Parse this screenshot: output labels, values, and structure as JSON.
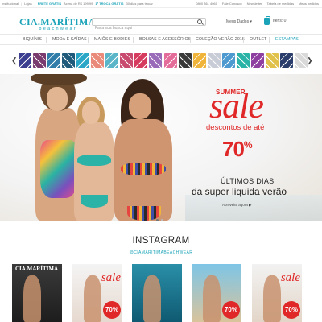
{
  "topbar": {
    "left": [
      "Institucional",
      "Lojas",
      "FRETE GRÁTIS",
      "Acima de R$ 199,99",
      "1ª TROCA GRÁTIS",
      "30 dias para trocar"
    ],
    "right": [
      "0800 361 4061",
      "Fale Conosco",
      "Newsletter",
      "Tabela de medidas",
      "Meus pedidos"
    ]
  },
  "header": {
    "logo_main": "CIA.MARÍTIMA",
    "logo_sub": "beachwear",
    "search_placeholder": "Faça sua busca aqui",
    "account_label": "Meus Dados ▾",
    "cart_label": "Itens: 0"
  },
  "nav": {
    "items": [
      "BIQUÍNIS",
      "MODA E SAÍDAS",
      "MAIÔS E BODIES",
      "BOLSAS E ACESSÓRIOS",
      "COLEÇÃO VERÃO 2015",
      "OUTLET",
      "ESTAMPAS"
    ],
    "active": "ESTAMPAS"
  },
  "swatches": {
    "prev_arrow": "❮",
    "next_arrow": "❯",
    "colors": [
      "#3c3f8f",
      "#7a3b6e",
      "#2f7da8",
      "#1f5a7a",
      "#2aa7c6",
      "#e98a7a",
      "#5ab5c8",
      "#c84a6f",
      "#d63a5e",
      "#9a6bb8",
      "#e46c9a",
      "#3a3a3a",
      "#f1b43b",
      "#c8ccd6",
      "#4c9ad0",
      "#2bb3a8",
      "#8e3fa0",
      "#e0c24a",
      "#2b3d6b",
      "#d9d9d9"
    ]
  },
  "banner": {
    "summer": "SUMMER",
    "sale": "sale",
    "descontos": "descontos de até",
    "pct": "70",
    "pct_sign": "%",
    "ultimos": "ÚLTIMOS DIAS",
    "liquida": "da super liquida verão",
    "aproveite": "Aproveite agora ▶"
  },
  "instagram": {
    "title": "INSTAGRAM",
    "handle": "@CIAMARITIMABEACHWEAR",
    "tiles": [
      {
        "bg": "linear-gradient(180deg,#3a3a3a 0%,#1d1d1d 100%)",
        "logo": "CIA.MARÍTIMA",
        "sale": "",
        "pct": ""
      },
      {
        "bg": "linear-gradient(180deg,#f4f4f4 0%,#e6d9cf 100%)",
        "logo": "",
        "sale": "sale",
        "pct": "70%"
      },
      {
        "bg": "linear-gradient(180deg,#2a8fa8 0%,#0f5a72 100%)",
        "logo": "",
        "sale": "",
        "pct": ""
      },
      {
        "bg": "linear-gradient(180deg,#7ec5e6 0%,#d9c49c 100%)",
        "logo": "",
        "sale": "",
        "pct": "70%"
      },
      {
        "bg": "linear-gradient(180deg,#f2f2f2 0%,#e3d6c8 100%)",
        "logo": "",
        "sale": "sale",
        "pct": "70%"
      }
    ]
  }
}
